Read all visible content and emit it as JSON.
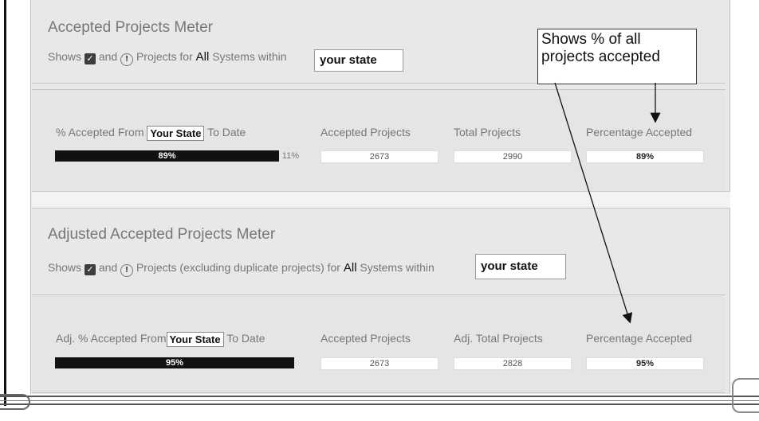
{
  "meter1": {
    "title": "Accepted Projects Meter",
    "sub_shows": "Shows",
    "sub_and": "and",
    "sub_projects": "Projects for",
    "sub_all": "All",
    "sub_systems": "Systems within",
    "state_box": "your state",
    "col1_prefix": "% Accepted From",
    "col1_state": "Your State",
    "col1_suffix": "To Date",
    "bar_label": "89%",
    "bar_fraction": 0.89,
    "bar_remainder": "11%",
    "col2_label": "Accepted Projects",
    "col2_value": "2673",
    "col3_label": "Total Projects",
    "col3_value": "2990",
    "col4_label": "Percentage Accepted",
    "col4_value": "89%"
  },
  "meter2": {
    "title": "Adjusted Accepted Projects Meter",
    "sub_shows": "Shows",
    "sub_and": "and",
    "sub_projects": "Projects (excluding duplicate projects) for",
    "sub_all": "All",
    "sub_systems": "Systems within",
    "state_box": "your state",
    "col1_prefix": "Adj. % Accepted From",
    "col1_state": "Your State",
    "col1_suffix": "To Date",
    "bar_label": "95%",
    "bar_fraction": 0.95,
    "col2_label": "Accepted Projects",
    "col2_value": "2673",
    "col3_label": "Adj. Total Projects",
    "col3_value": "2828",
    "col4_label": "Percentage Accepted",
    "col4_value": "95%"
  },
  "callout": {
    "line1": "Shows % of all",
    "line2": "projects accepted"
  },
  "icons": {
    "check": "checkbox-checked-icon",
    "alert": "alert-icon"
  }
}
